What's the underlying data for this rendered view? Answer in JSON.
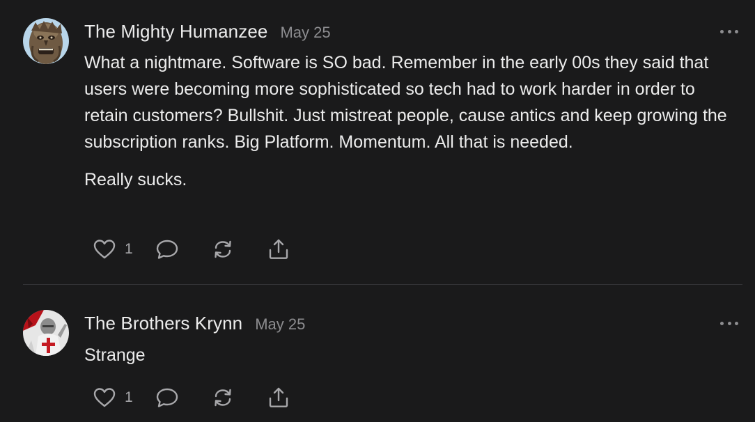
{
  "comments": [
    {
      "author": "The Mighty Humanzee",
      "date": "May 25",
      "avatar_icon": "ape-face-avatar",
      "paragraphs": [
        "What a nightmare. Software is SO bad. Remember in the early 00s they said that users were becoming more sophisticated so tech had to work harder in order to retain customers? Bullshit. Just mistreat people, cause antics and keep growing the subscription ranks. Big Platform. Momentum. All that is needed.",
        "Really sucks."
      ],
      "likes": "1"
    },
    {
      "author": "The Brothers Krynn",
      "date": "May 25",
      "avatar_icon": "crusader-knight-avatar",
      "paragraphs": [
        "Strange"
      ],
      "likes": "1"
    }
  ],
  "icons": {
    "like": "heart-icon",
    "reply": "comment-bubble-icon",
    "restack": "restack-arrows-icon",
    "share": "share-icon",
    "more": "more-dots-icon"
  },
  "colors": {
    "background": "#1a1a1b",
    "text": "#ececec",
    "muted": "#8d8d90",
    "divider": "#333336"
  }
}
